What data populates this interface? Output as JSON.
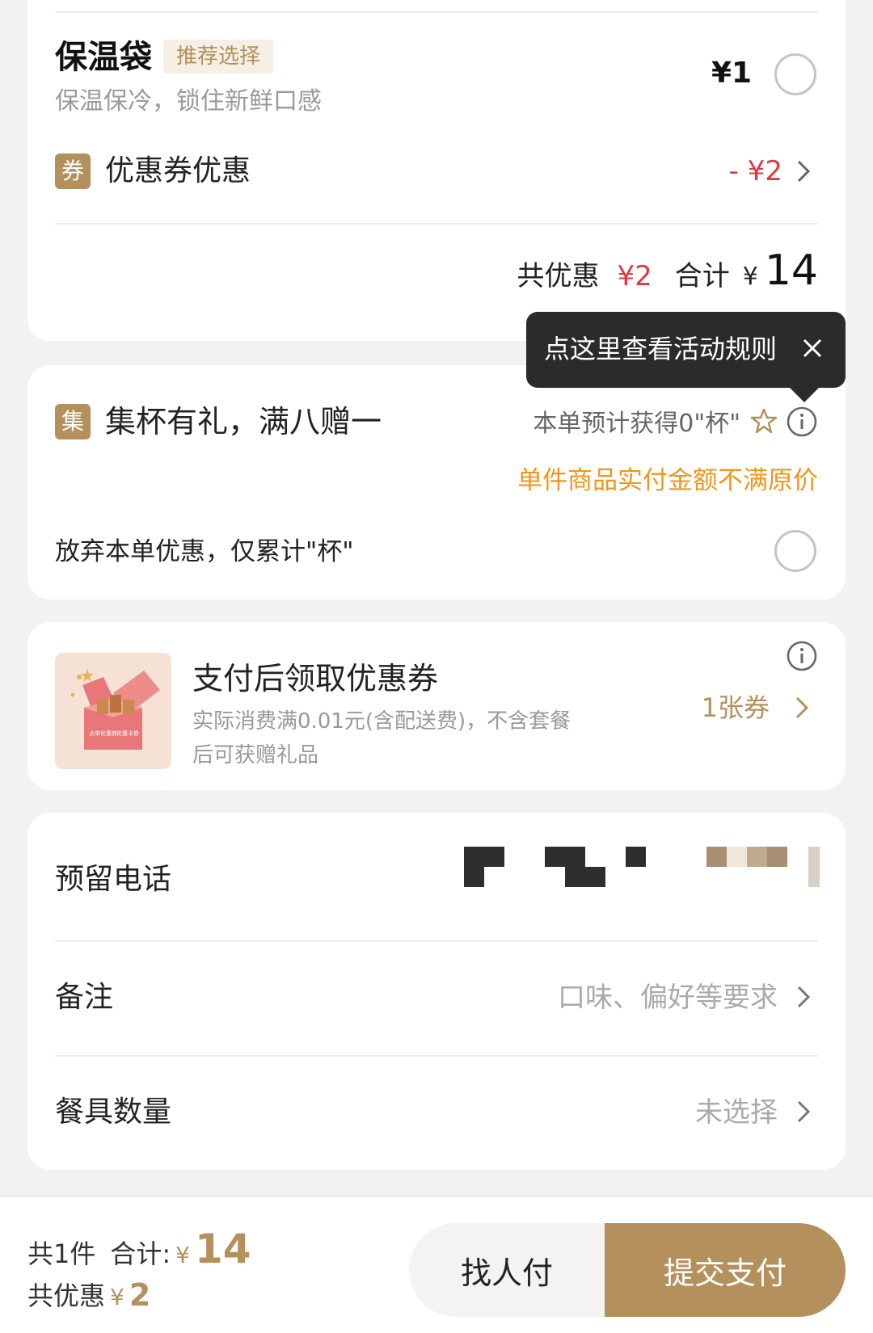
{
  "bag": {
    "title": "保温袋",
    "tag": "推荐选择",
    "subtitle": "保温保冷，锁住新鲜口感",
    "price": "¥1"
  },
  "coupon": {
    "badge": "券",
    "label": "优惠券优惠",
    "amount": "- ¥2"
  },
  "summary": {
    "discount_label": "共优惠",
    "discount_value": "¥2",
    "total_label": "合计",
    "currency": "¥",
    "total_value": "14"
  },
  "tooltip": {
    "text": "点这里查看活动规则",
    "close": "✕"
  },
  "collect": {
    "badge": "集",
    "title": "集杯有礼，满八赠一",
    "estimate": "本单预计获得0\"杯\"",
    "warning": "单件商品实付金额不满原价",
    "abandon": "放弃本单优惠，仅累计\"杯\""
  },
  "gift": {
    "title": "支付后领取优惠券",
    "line1": "实际消费满0.01元(含配送费)，不含套餐",
    "line2": "后可获赠礼品",
    "count": "1张券",
    "box_text_left": "点单优惠券",
    "box_text_right": "优惠卡券"
  },
  "contact": {
    "phone_label": "预留电话",
    "note_label": "备注",
    "note_placeholder": "口味、偏好等要求",
    "utensils_label": "餐具数量",
    "utensils_value": "未选择"
  },
  "footer": {
    "count": "共1件",
    "total_label": "合计:",
    "currency": "¥",
    "total_value": "14",
    "discount_label": "共优惠",
    "discount_currency": "¥",
    "discount_value": "2",
    "others_pay": "找人付",
    "submit": "提交支付"
  },
  "colors": {
    "accent": "#b4905c",
    "red": "#e0393e",
    "orange": "#f0961c",
    "dark": "#2b2b2b"
  },
  "icons": [
    "chevron-right-icon",
    "info-icon",
    "star-icon",
    "close-icon",
    "radio-icon",
    "gift-box-icon"
  ]
}
